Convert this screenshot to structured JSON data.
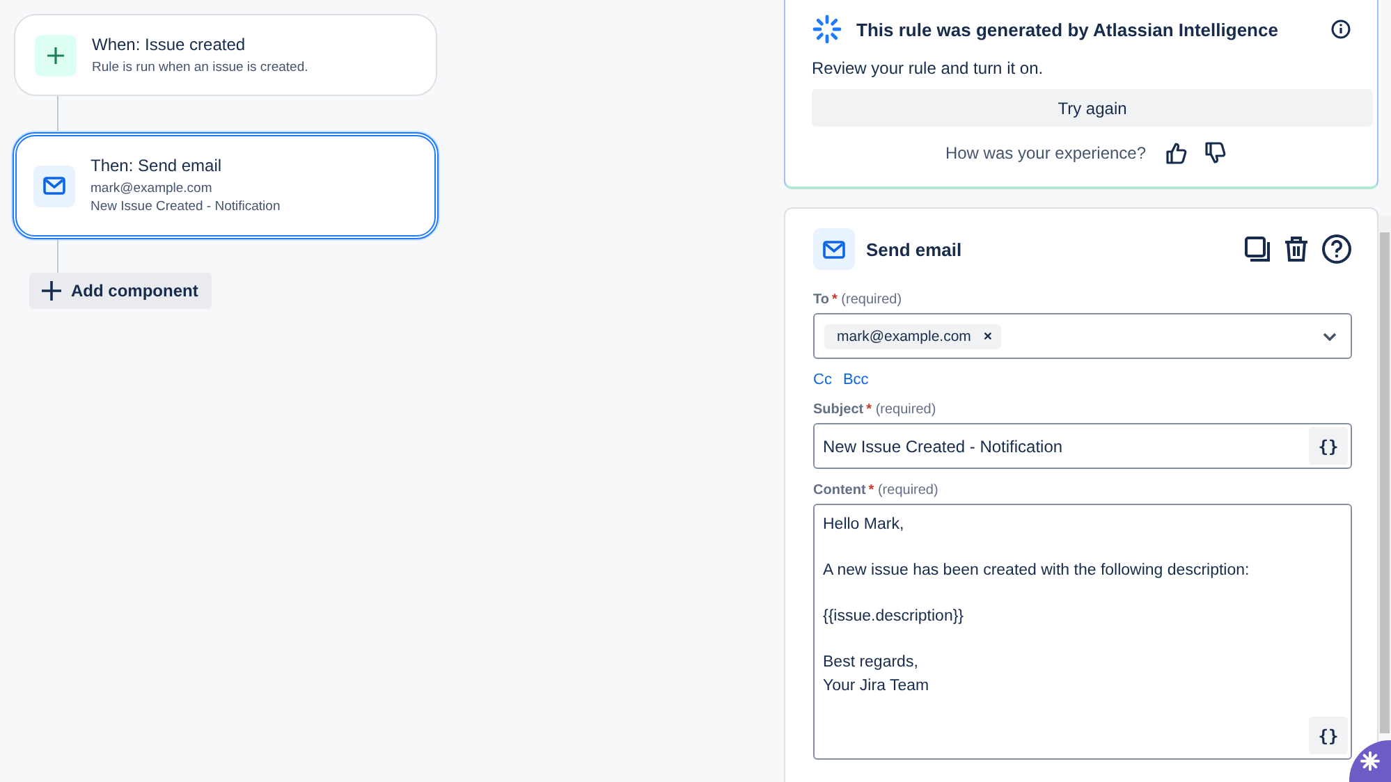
{
  "rule_nodes": [
    {
      "kind": "trigger",
      "title": "When: Issue created",
      "lines": [
        "Rule is run when an issue is created."
      ],
      "selected": false
    },
    {
      "kind": "email",
      "title": "Then: Send email",
      "lines": [
        "mark@example.com",
        "New Issue Created - Notification"
      ],
      "selected": true
    }
  ],
  "add_component": "Add component",
  "ai_banner": {
    "title": "This rule was generated by Atlassian Intelligence",
    "message": "Review your rule and turn it on.",
    "retry_button": "Try again",
    "feedback_prompt": "How was your experience?"
  },
  "editor": {
    "title": "Send email",
    "to": {
      "label": "To",
      "required_mark": "*",
      "hint": "(required)",
      "chips": [
        {
          "text": "mark@example.com",
          "remove": "×"
        }
      ]
    },
    "links": [
      "Cc",
      "Bcc"
    ],
    "subject": {
      "label": "Subject",
      "required_mark": "*",
      "hint": "(required)",
      "value": "New Issue Created - Notification",
      "variable_button": "{}"
    },
    "content": {
      "label": "Content",
      "required_mark": "*",
      "hint": "(required)",
      "paragraphs": [
        [
          "Hello Mark,"
        ],
        [
          "A new issue has been created with the following description:"
        ],
        [
          "{{issue.description}}"
        ],
        [
          "Best regards,",
          "Your Jira Team"
        ]
      ],
      "variable_button": "{}"
    }
  }
}
